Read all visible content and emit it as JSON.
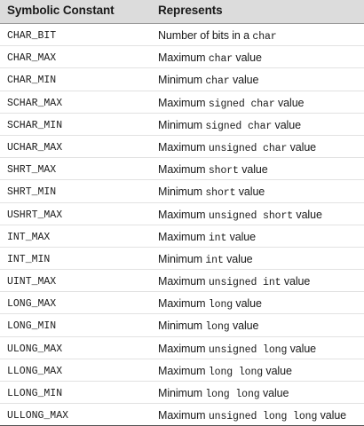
{
  "header": {
    "col1": "Symbolic Constant",
    "col2": "Represents"
  },
  "rows": [
    {
      "constant": "CHAR_BIT",
      "pre": "Number of bits in a ",
      "code": "char",
      "post": ""
    },
    {
      "constant": "CHAR_MAX",
      "pre": "Maximum ",
      "code": "char",
      "post": " value"
    },
    {
      "constant": "CHAR_MIN",
      "pre": "Minimum ",
      "code": "char",
      "post": " value"
    },
    {
      "constant": "SCHAR_MAX",
      "pre": "Maximum ",
      "code": "signed char",
      "post": " value"
    },
    {
      "constant": "SCHAR_MIN",
      "pre": "Minimum ",
      "code": "signed char",
      "post": " value"
    },
    {
      "constant": "UCHAR_MAX",
      "pre": "Maximum ",
      "code": "unsigned char",
      "post": " value"
    },
    {
      "constant": "SHRT_MAX",
      "pre": "Maximum ",
      "code": "short",
      "post": " value"
    },
    {
      "constant": "SHRT_MIN",
      "pre": "Minimum ",
      "code": "short",
      "post": " value"
    },
    {
      "constant": "USHRT_MAX",
      "pre": "Maximum ",
      "code": "unsigned short",
      "post": " value"
    },
    {
      "constant": "INT_MAX",
      "pre": "Maximum ",
      "code": "int",
      "post": " value"
    },
    {
      "constant": "INT_MIN",
      "pre": "Minimum ",
      "code": "int",
      "post": " value"
    },
    {
      "constant": "UINT_MAX",
      "pre": "Maximum ",
      "code": "unsigned int",
      "post": " value"
    },
    {
      "constant": "LONG_MAX",
      "pre": "Maximum ",
      "code": "long",
      "post": " value"
    },
    {
      "constant": "LONG_MIN",
      "pre": "Minimum ",
      "code": "long",
      "post": " value"
    },
    {
      "constant": "ULONG_MAX",
      "pre": "Maximum ",
      "code": "unsigned long",
      "post": " value"
    },
    {
      "constant": "LLONG_MAX",
      "pre": "Maximum ",
      "code": "long long",
      "post": " value"
    },
    {
      "constant": "LLONG_MIN",
      "pre": "Minimum ",
      "code": "long long",
      "post": " value"
    },
    {
      "constant": "ULLONG_MAX",
      "pre": "Maximum ",
      "code": "unsigned long long",
      "post": " value"
    }
  ]
}
